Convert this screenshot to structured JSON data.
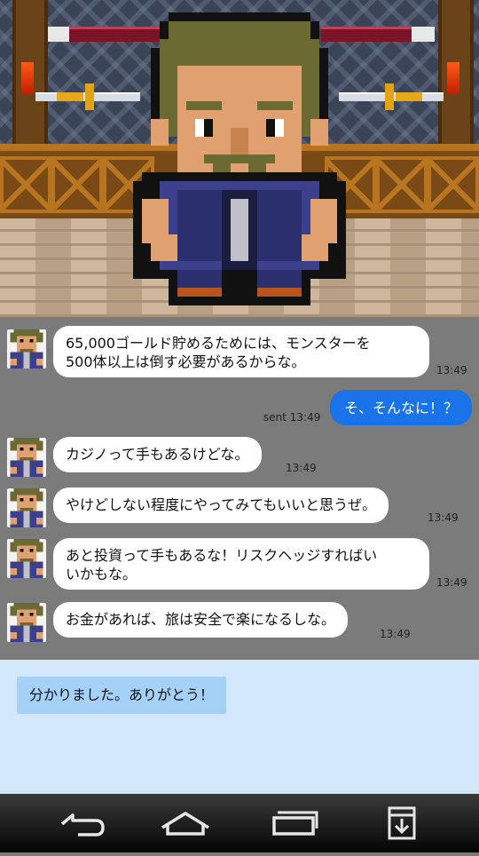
{
  "scene": {
    "character": "bearded-warrior-npc",
    "torch_color": "#ff4a10",
    "wall_color": "#3b4357",
    "fence_color": "#7a4a16",
    "floor_color": "#c7ad90"
  },
  "chat": {
    "messages": [
      {
        "from": "npc",
        "lines": [
          "65,000ゴールド貯めるためには、モンスターを",
          "500体以上は倒す必要があるからな。"
        ],
        "time": "13:49"
      },
      {
        "from": "player",
        "text": "そ、そんなに！？",
        "time": "sent 13:49"
      },
      {
        "from": "npc",
        "lines": [
          "カジノって手もあるけどな。"
        ],
        "time": "13:49"
      },
      {
        "from": "npc",
        "lines": [
          "やけどしない程度にやってみてもいいと思うぜ。"
        ],
        "time": "13:49"
      },
      {
        "from": "npc",
        "lines": [
          "あと投資って手もあるな！リスクヘッジすればい",
          "いかもな。"
        ],
        "time": "13:49"
      },
      {
        "from": "npc",
        "lines": [
          "お金があれば、旅は安全で楽になるしな。"
        ],
        "time": "13:49"
      }
    ]
  },
  "choices": {
    "option1": "分かりました。ありがとう！"
  },
  "navbar": {
    "back": "back-icon",
    "home": "home-icon",
    "recents": "recents-icon",
    "save": "download-icon"
  },
  "colors": {
    "chat_bg": "#7b7b7b",
    "sent_bubble": "#1a73e8",
    "choice_panel": "#d3e9fb",
    "choice_button": "#a6d1f6"
  }
}
